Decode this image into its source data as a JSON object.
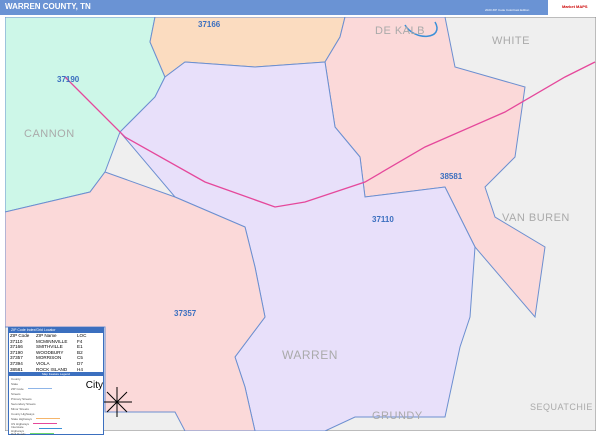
{
  "header": {
    "title": "WARREN COUNTY, TN",
    "edition": "2020 ZIP Code ColorCast Edition",
    "logo": "Market MAPS"
  },
  "map": {
    "counties": [
      "WHITE",
      "CANNON",
      "VAN BUREN",
      "WARREN",
      "GRUNDY",
      "SEQUATCHIE",
      "DE KALB"
    ],
    "zips": [
      "37166",
      "37190",
      "38581",
      "37110",
      "37357"
    ],
    "colors": {
      "37190": "#cdf7e8",
      "37166": "#fbdcc0",
      "37110": "#e8e0fa",
      "38581": "#fbd9d9",
      "37357": "#fbd9d9",
      "outside": "#efefef",
      "border": "#6c8fd0",
      "highway": "#e5489b"
    }
  },
  "legend": {
    "title": "ZIP Code Index/Grid Locator",
    "headers": [
      "ZIP Code",
      "ZIP Name",
      "LOC"
    ],
    "rows": [
      [
        "37110",
        "MCMINNVILLE",
        "F4"
      ],
      [
        "37166",
        "SMITHVILLE",
        "E1"
      ],
      [
        "37190",
        "WOODBURY",
        "B2"
      ],
      [
        "37357",
        "MORRISON",
        "C5"
      ],
      [
        "37394",
        "VIOLA",
        "D7"
      ],
      [
        "38581",
        "ROCK ISLAND",
        "H4"
      ]
    ],
    "subtitle": "Map Feature Legend",
    "keys": [
      "County",
      "State",
      "ZIP Code",
      "Streets",
      "Primary Streets",
      "Secondary Streets",
      "Minor Streets",
      "County Highways",
      "State Highways",
      "US Highways",
      "Interstate Highways",
      "Rail Roads"
    ],
    "city": "City"
  }
}
